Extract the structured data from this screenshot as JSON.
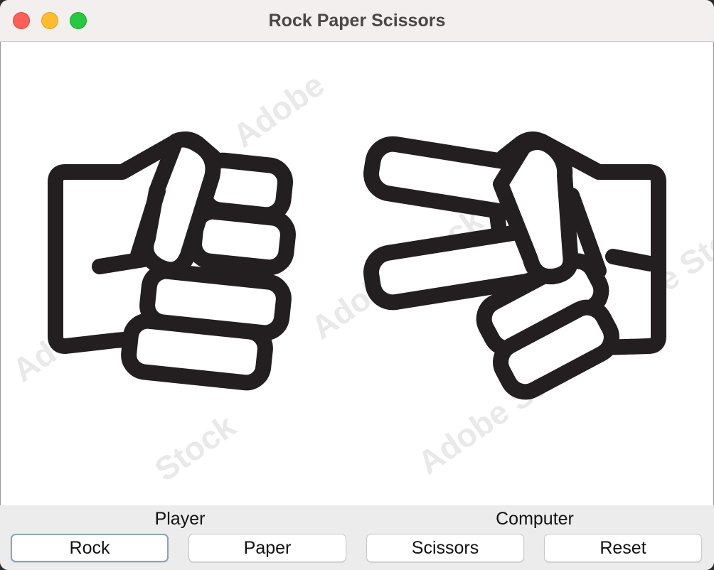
{
  "window": {
    "title": "Rock Paper Scissors"
  },
  "image": {
    "description_icons": [
      "rock-fist-icon",
      "scissors-hand-icon"
    ],
    "stroke_color": "#231f20",
    "watermark": "Adobe Stock"
  },
  "labels": {
    "player": "Player",
    "computer": "Computer"
  },
  "buttons": {
    "rock": "Rock",
    "paper": "Paper",
    "scissors": "Scissors",
    "reset": "Reset"
  },
  "colors": {
    "close": "#fe5f57",
    "minimize": "#febc2e",
    "zoom": "#28c840",
    "focus_ring": "#8ea2b8"
  }
}
